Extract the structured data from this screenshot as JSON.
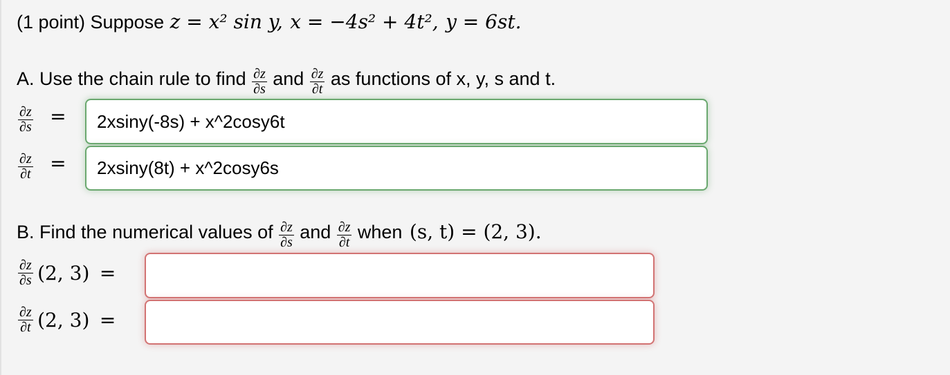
{
  "problem": {
    "points_label": "(1 point) Suppose",
    "z_def": "z = x² sin y,",
    "x_def": "x = −4s² + 4t²,",
    "y_def": "y = 6st."
  },
  "part_a": {
    "prompt_prefix": "A. Use the chain rule to find",
    "and": "and",
    "prompt_suffix": "as functions of x, y, s and t.",
    "frac_num": "∂z",
    "frac_den_s": "∂s",
    "frac_den_t": "∂t",
    "eq": "=",
    "answers": [
      {
        "label": "dz/ds",
        "value": "2xsiny(-8s) + x^2cosy6t",
        "status": "correct",
        "status_color": "#6aa86f"
      },
      {
        "label": "dz/dt",
        "value": "2xsiny(8t) + x^2cosy6s",
        "status": "correct",
        "status_color": "#6aa86f"
      }
    ]
  },
  "part_b": {
    "prompt_prefix": "B. Find the numerical values of",
    "and": "and",
    "when": "when",
    "point": "(s, t) = (2, 3).",
    "at_point": "(2, 3)",
    "eq": "=",
    "answers": [
      {
        "label": "dz/ds(2,3)",
        "value": "",
        "status": "incorrect",
        "status_color": "#d27373"
      },
      {
        "label": "dz/dt(2,3)",
        "value": "",
        "status": "incorrect",
        "status_color": "#d27373"
      }
    ]
  }
}
